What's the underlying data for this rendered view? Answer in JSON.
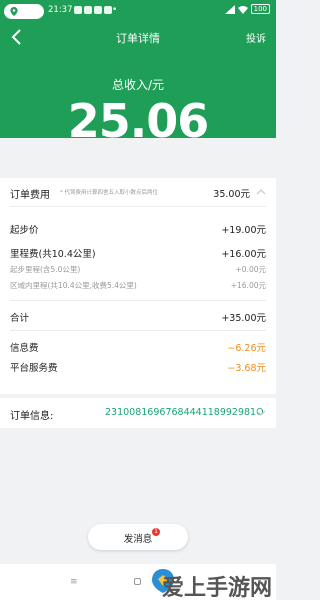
{
  "status": {
    "time": "21:37",
    "dot": "•",
    "battery": "100"
  },
  "nav": {
    "title": "订单详情",
    "complain": "投诉"
  },
  "income": {
    "label": "总收入/元",
    "value": "25.06"
  },
  "fee": {
    "title": "订单费用",
    "note": "* 代驾费用计算四舍五入取小数点后两位",
    "total": "35.00元",
    "rows": [
      {
        "label": "起步价",
        "value": "+19.00元"
      },
      {
        "label": "里程费(共10.4公里)",
        "value": "+16.00元"
      },
      {
        "label": "起步里程(含5.0公里)",
        "value": "+0.00元"
      },
      {
        "label": "区域内里程(共10.4公里,收费5.4公里)",
        "value": "+16.00元"
      },
      {
        "label": "合计",
        "value": "+35.00元"
      },
      {
        "label": "信息费",
        "value": "−6.26元"
      },
      {
        "label": "平台服务费",
        "value": "−3.68元"
      }
    ]
  },
  "order": {
    "label": "订单信息:",
    "number": "2310081696768444118992981O"
  },
  "message": {
    "label": "发消息",
    "badge": "1"
  },
  "watermark": {
    "text": "爱上手游网"
  },
  "colors": {
    "brand_green": "#1f9e57",
    "deduction_orange": "#f08c1a",
    "order_number": "#1aa37a",
    "badge_red": "#e53935"
  }
}
